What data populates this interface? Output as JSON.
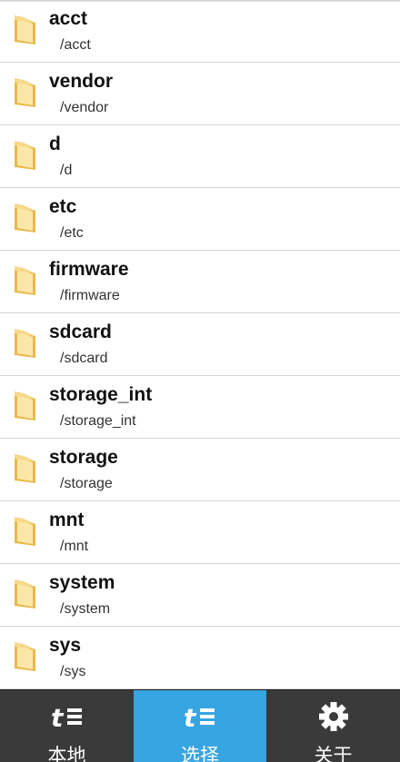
{
  "file_list": {
    "items": [
      {
        "name": "acct",
        "path": "/acct"
      },
      {
        "name": "vendor",
        "path": "/vendor"
      },
      {
        "name": "d",
        "path": "/d"
      },
      {
        "name": "etc",
        "path": "/etc"
      },
      {
        "name": "firmware",
        "path": "/firmware"
      },
      {
        "name": "sdcard",
        "path": "/sdcard"
      },
      {
        "name": "storage_int",
        "path": "/storage_int"
      },
      {
        "name": "storage",
        "path": "/storage"
      },
      {
        "name": "mnt",
        "path": "/mnt"
      },
      {
        "name": "system",
        "path": "/system"
      },
      {
        "name": "sys",
        "path": "/sys"
      }
    ],
    "item_icon": "folder-icon"
  },
  "tabbar": {
    "tabs": [
      {
        "label": "本地",
        "icon": "te-logo-icon",
        "active": false
      },
      {
        "label": "选择",
        "icon": "te-logo-icon",
        "active": true
      },
      {
        "label": "关于",
        "icon": "gear-icon",
        "active": false
      }
    ]
  },
  "colors": {
    "active_tab": "#37a5e2",
    "tabbar_bg": "#3a3a3a",
    "folder": "#f3d27a"
  }
}
